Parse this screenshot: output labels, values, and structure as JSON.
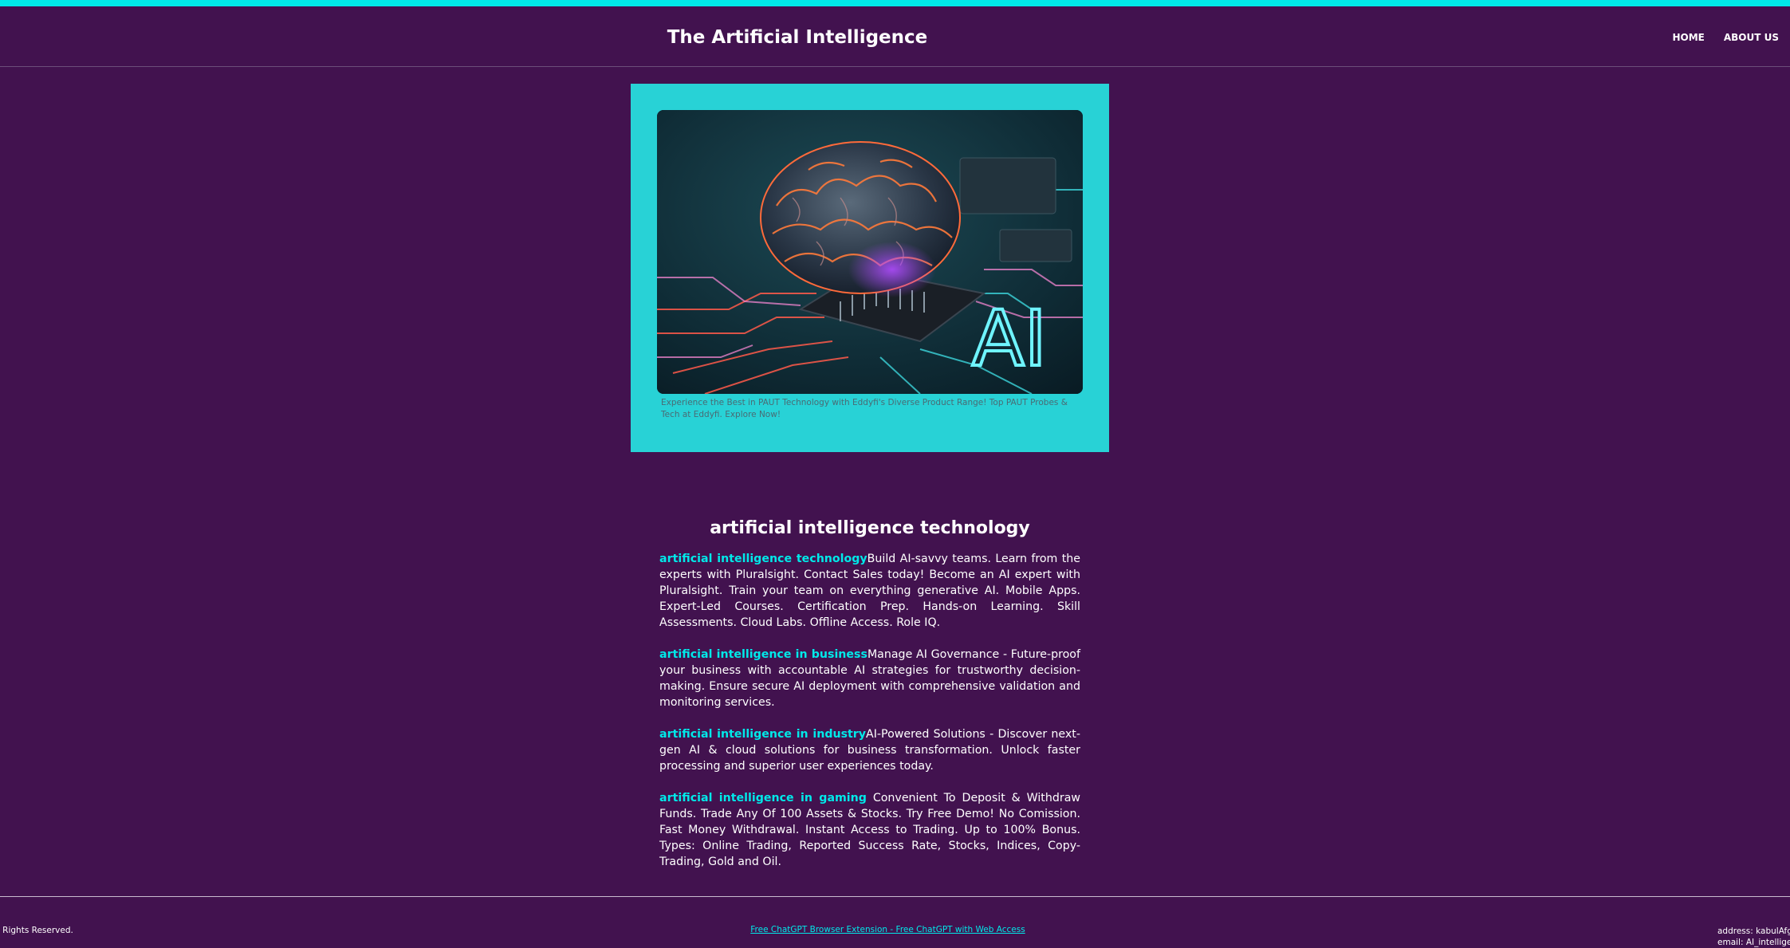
{
  "header": {
    "title": "The Artificial Intelligence",
    "nav": [
      {
        "label": "HOME"
      },
      {
        "label": "ABOUT US"
      }
    ]
  },
  "hero": {
    "overlay_text": "AI",
    "caption": "Experience the Best in PAUT Technology with Eddyfi's Diverse Product Range! Top PAUT Probes & Tech at Eddyfi. Explore Now!"
  },
  "article": {
    "heading": "artificial intelligence technology",
    "paragraphs": [
      {
        "keyword": "artificial intelligence technology",
        "text": "Build AI-savvy teams. Learn from the experts with Pluralsight. Contact Sales today! Become an AI expert with Pluralsight. Train your team on everything generative AI. Mobile Apps. Expert-Led Courses. Certification Prep. Hands-on Learning. Skill Assessments. Cloud Labs. Offline Access. Role IQ."
      },
      {
        "keyword": "artificial intelligence in business",
        "text": "Manage AI Governance - Future-proof your business with accountable AI strategies for trustworthy decision-making. Ensure secure AI deployment with comprehensive validation and monitoring services."
      },
      {
        "keyword": "artificial intelligence in industry",
        "text": "AI-Powered Solutions - Discover next-gen AI & cloud solutions for business transformation. Unlock faster processing and superior user experiences today."
      },
      {
        "keyword": "artificial intelligence in gaming",
        "text": " Convenient To Deposit & Withdraw Funds. Trade Any Of 100 Assets & Stocks. Try Free Demo! No Comission. Fast Money Withdrawal. Instant Access to Trading. Up to 100% Bonus. Types: Online Trading, Reported Success Rate, Stocks, Indices, Copy-Trading, Gold and Oil."
      }
    ]
  },
  "footer": {
    "rights": "ll Rights Reserved.",
    "link": "Free ChatGPT Browser Extension - Free ChatGPT with Web Access",
    "address": "address: kabulAfghanistan",
    "email": "email: AI_intelligence"
  },
  "colors": {
    "background": "#42124f",
    "accent": "#00e9e9",
    "card": "#28d2d6"
  }
}
